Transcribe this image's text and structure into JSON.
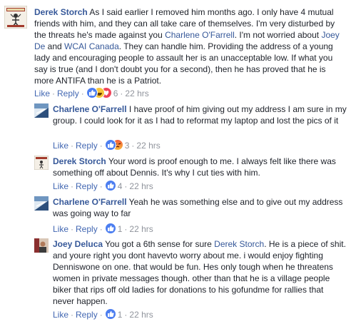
{
  "comments": [
    {
      "author": "Derek Storch",
      "text_parts": [
        " As I said earlier I removed him months ago. I only have 4 mutual friends with him, and they can all take care of themselves. I'm very disturbed by the threats he's made against you ",
        "Charlene O'Farrell",
        ". I'm not worried about ",
        "Joey De",
        " and ",
        "WCAI Canada",
        ". They can handle him. Providing the address of a young lady and encouraging people to assault her is an unacceptable low. If what you say is true (and I don't doubt you for a second), then he has proved that he is more ANTIFA than he is a Patriot."
      ],
      "like_label": "Like",
      "reply_label": "Reply",
      "reaction_count": "6",
      "time": "22 hrs",
      "reactions": [
        "like-icon",
        "haha-icon",
        "love-icon"
      ]
    },
    {
      "author": "Charlene O'Farrell",
      "text": " I have proof of him giving out my address I am sure in my group. I could look for it as I had to reformat my laptop and lost the pics of it",
      "like_label": "Like",
      "reply_label": "Reply",
      "reaction_count": "3",
      "time": "22 hrs",
      "reactions": [
        "like-icon",
        "angry-icon"
      ]
    },
    {
      "author": "Derek Storch",
      "text": " Your word is proof enough to me. I always felt like there was something off about Dennis. It's why I cut ties with him.",
      "like_label": "Like",
      "reply_label": "Reply",
      "reaction_count": "4",
      "time": "22 hrs",
      "reactions": [
        "like-icon"
      ]
    },
    {
      "author": "Charlene O'Farrell",
      "text": " Yeah he was something else and to give out my address was going way to far",
      "like_label": "Like",
      "reply_label": "Reply",
      "reaction_count": "1",
      "time": "22 hrs",
      "reactions": [
        "like-icon"
      ]
    },
    {
      "author": "Joey Deluca",
      "text_parts": [
        " You got a 6th sense for sure ",
        "Derek Storch",
        ". He is a piece of shit. and youre right you dont havevto worry about me. i would enjoy fighting Denniswone on one. that would be fun. Hes only tough when he threatens women in private messages though. other than that he is a village people biker that rips off old ladies for donations to his gofundme for rallies that never happen."
      ],
      "like_label": "Like",
      "reply_label": "Reply",
      "reaction_count": "1",
      "time": "22 hrs",
      "reactions": [
        "like-icon"
      ]
    }
  ],
  "colors": {
    "author": "#365899",
    "link": "#4267b2",
    "meta": "#90949c",
    "text": "#1d2129"
  }
}
